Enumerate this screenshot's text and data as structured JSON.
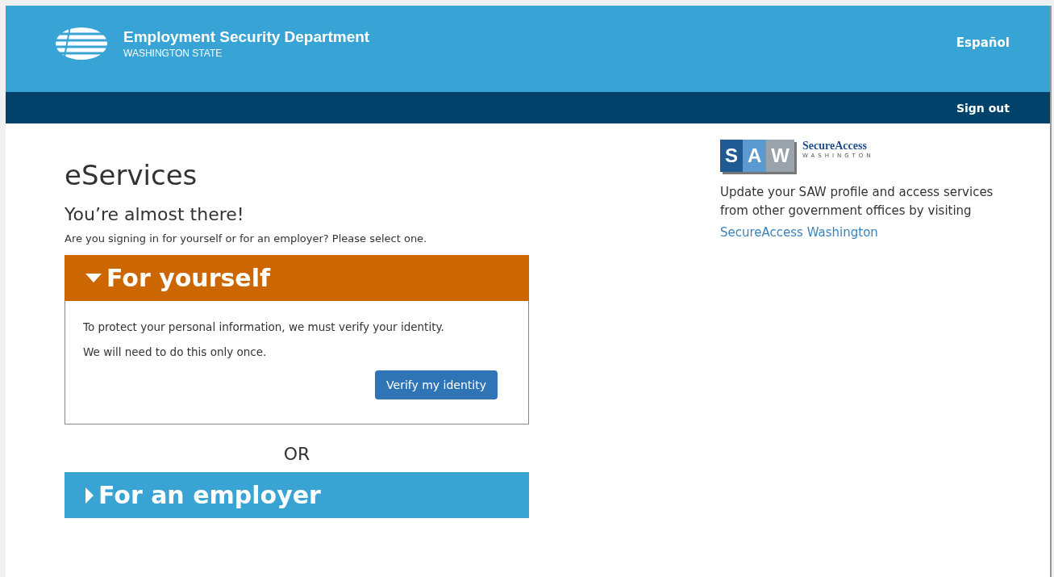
{
  "header": {
    "title": "Employment Security Department",
    "subtitle": "WASHINGTON STATE",
    "language_link": "Español"
  },
  "nav": {
    "sign_out": "Sign out"
  },
  "main": {
    "title": "eServices",
    "subtitle": "You’re almost there!",
    "prompt": "Are you signing in for yourself or for an employer? Please select one.",
    "sections": [
      {
        "label": "For yourself",
        "expanded": true,
        "color": "#cc6600",
        "lines": [
          "To protect your personal information, we must verify your identity.",
          "We will need to do this only once."
        ],
        "button": "Verify my identity"
      },
      {
        "label": "For an employer",
        "expanded": false,
        "color": "#39a3d4"
      }
    ],
    "separator": "OR"
  },
  "aside": {
    "logo_letters": [
      "S",
      "A",
      "W"
    ],
    "logo_name": "SecureAccess",
    "logo_tagline": "WASHINGTON",
    "text": "Update your SAW profile and access services from other government offices by visiting",
    "link": "SecureAccess Washington"
  }
}
